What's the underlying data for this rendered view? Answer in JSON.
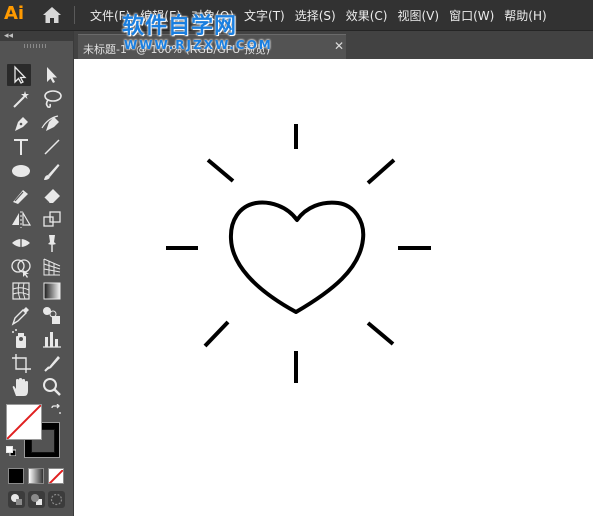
{
  "app": {
    "logo": "Ai"
  },
  "menu": {
    "items": [
      "文件(F)",
      "编辑(E)",
      "对象(O)",
      "文字(T)",
      "选择(S)",
      "效果(C)",
      "视图(V)",
      "窗口(W)",
      "帮助(H)"
    ]
  },
  "watermark": {
    "title": "软件自学网",
    "url": "WWW.RJZXW.COM"
  },
  "tab": {
    "title": "未标题-1* @ 100% (RGB/GPU 预览)",
    "close": "✕"
  },
  "tool_panel": {
    "collapse": "◂◂"
  },
  "tools": [
    "selection-tool",
    "direct-selection-tool",
    "magic-wand-tool",
    "lasso-tool",
    "pen-tool",
    "curvature-tool",
    "type-tool",
    "line-segment-tool",
    "ellipse-tool",
    "paintbrush-tool",
    "shaper-tool",
    "eraser-tool",
    "reflect-tool",
    "scale-tool",
    "width-tool",
    "puppet-warp-tool",
    "shape-builder-tool",
    "perspective-grid-tool",
    "mesh-tool",
    "gradient-tool",
    "eyedropper-tool",
    "blend-tool",
    "symbol-sprayer-tool",
    "column-graph-tool",
    "artboard-tool",
    "slice-tool",
    "hand-tool",
    "zoom-tool"
  ],
  "colors": {
    "fill": "none",
    "stroke": "#000000",
    "none_mark": "#e02020"
  },
  "canvas": {
    "artwork": "heart with sun rays",
    "stroke_color": "#000000",
    "ray_count": 8
  }
}
